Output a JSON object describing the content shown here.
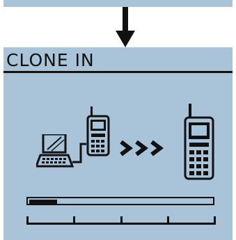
{
  "screen": {
    "title": "CLONE IN",
    "background_color": "#a9c3d9",
    "ink_color": "#111111"
  },
  "flow_arrow": {
    "icon": "down-arrow-icon",
    "direction": "down"
  },
  "illustration": {
    "source_icon": "computer-icon",
    "cable_radio_icon": "handheld-radio-icon",
    "transfer_icon": "triple-chevron-right-icon",
    "target_icon": "handheld-radio-icon"
  },
  "progress": {
    "fraction": 0.15,
    "segments": 4
  }
}
